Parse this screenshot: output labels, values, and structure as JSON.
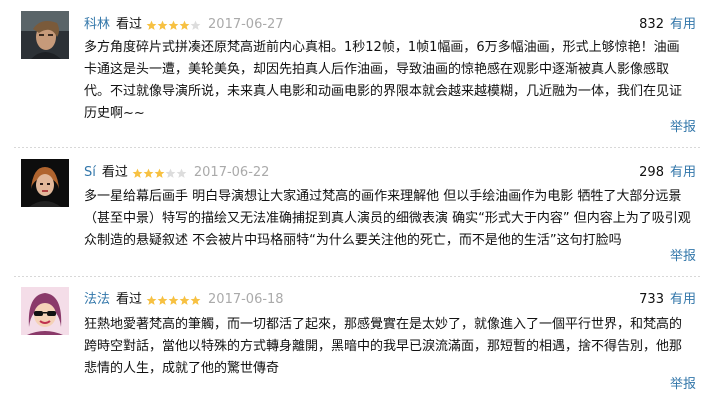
{
  "reviews": [
    {
      "author": "科林",
      "seen": "看过",
      "rating": 4,
      "date": "2017-06-27",
      "votes": "832",
      "useful_label": "有用",
      "content": "多方角度碎片式拼凑还原梵高逝前内心真相。1秒12帧，1帧1幅画，6万多幅油画，形式上够惊艳！油画卡通这是头一遭，美轮美奂，却因先拍真人后作油画，导致油画的惊艳感在观影中逐渐被真人影像感取代。不过就像导演所说，未来真人电影和动画电影的界限本就会越来越模糊，几近融为一体，我们在见证历史啊~~",
      "report_label": "举报"
    },
    {
      "author": "Sí",
      "seen": "看过",
      "rating": 3,
      "date": "2017-06-22",
      "votes": "298",
      "useful_label": "有用",
      "content": "多一星给幕后画手 明白导演想让大家通过梵高的画作来理解他 但以手绘油画作为电影 牺牲了大部分远景（甚至中景）特写的描绘又无法准确捕捉到真人演员的细微表演 确实“形式大于内容” 但内容上为了吸引观众制造的悬疑叙述 不会被片中玛格丽特“为什么要关注他的死亡，而不是他的生活”这句打脸吗",
      "report_label": "举报"
    },
    {
      "author": "法法",
      "seen": "看过",
      "rating": 5,
      "date": "2017-06-18",
      "votes": "733",
      "useful_label": "有用",
      "content": "狂熱地愛著梵高的筆觸，而一切都活了起來，那感覺實在是太妙了，就像進入了一個平行世界，和梵高的跨時空對話，當他以特殊的方式轉身離開，黑暗中的我早已淚流滿面，那短暫的相遇，捨不得告別，他那悲情的人生，成就了他的驚世傳奇",
      "report_label": "举报"
    }
  ],
  "colors": {
    "link": "#3377aa",
    "star_on": "#f7c142",
    "star_off": "#dddddd",
    "date": "#aaaaaa"
  }
}
